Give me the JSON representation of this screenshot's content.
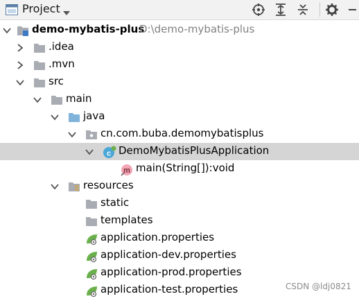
{
  "toolbar": {
    "title": "Project",
    "icons": [
      "project-view-icon",
      "chevron-down-icon",
      "locate-icon",
      "expand-all-icon",
      "collapse-all-icon",
      "gear-icon",
      "hide-icon"
    ]
  },
  "tree": {
    "root_label": "demo-mybatis-plus",
    "root_path": "D:\\demo-mybatis-plus",
    "idea": ".idea",
    "mvn": ".mvn",
    "src": "src",
    "main": "main",
    "java": "java",
    "package": "cn.com.buba.demomybatisplus",
    "app_class": "DemoMybatisPlusApplication",
    "main_method": "main(String[]):void",
    "resources": "resources",
    "static": "static",
    "templates": "templates",
    "props": [
      "application.properties",
      "application-dev.properties",
      "application-prod.properties",
      "application-test.properties"
    ]
  },
  "watermark": "CSDN @ldj0821",
  "colors": {
    "selected_row": "#d5d5d5",
    "folder": "#a9adb3",
    "source_folder": "#7fb3d9",
    "class_icon": "#4aa7d8",
    "spring_green": "#6ab04c"
  }
}
